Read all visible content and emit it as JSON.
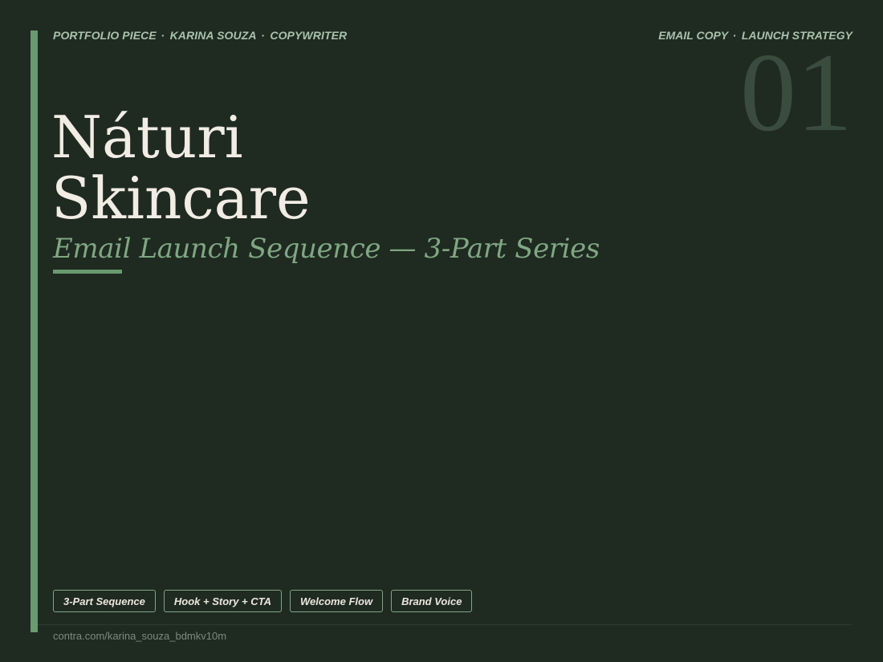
{
  "meta_left": [
    "PORTFOLIO PIECE",
    "KARINA SOUZA",
    "COPYWRITER"
  ],
  "meta_right": [
    "EMAIL COPY",
    "LAUNCH STRATEGY"
  ],
  "separator": "·",
  "piece_number": "01",
  "title_lines": [
    "Náturi",
    "Skincare"
  ],
  "subtitle": "Email Launch Sequence — 3-Part Series",
  "tags": [
    "3-Part Sequence",
    "Hook + Story + CTA",
    "Welcome Flow",
    "Brand Voice"
  ],
  "footer_url": "contra.com/karina_souza_bdmkv10m",
  "colors": {
    "background": "#1f2a21",
    "accent": "#6a9a70",
    "title": "#f1ece4",
    "subtitle": "#7fa783"
  }
}
